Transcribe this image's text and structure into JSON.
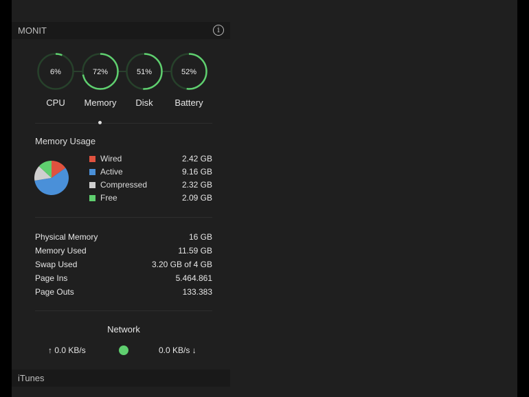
{
  "widget": {
    "title": "MONIT",
    "info_icon": "info-icon",
    "gauges": [
      {
        "label": "CPU",
        "value": "6%",
        "fraction": 0.06
      },
      {
        "label": "Memory",
        "value": "72%",
        "fraction": 0.72
      },
      {
        "label": "Disk",
        "value": "51%",
        "fraction": 0.51
      },
      {
        "label": "Battery",
        "value": "52%",
        "fraction": 0.52
      }
    ],
    "gauge_color": "#5fcf6f",
    "memory_usage": {
      "title": "Memory Usage",
      "items": [
        {
          "name": "Wired",
          "value": "2.42 GB",
          "gb": 2.42,
          "color": "#e0523f"
        },
        {
          "name": "Active",
          "value": "9.16 GB",
          "gb": 9.16,
          "color": "#4a90d9"
        },
        {
          "name": "Compressed",
          "value": "2.32 GB",
          "gb": 2.32,
          "color": "#cfcfcf"
        },
        {
          "name": "Free",
          "value": "2.09 GB",
          "gb": 2.09,
          "color": "#5fcf6f"
        }
      ]
    },
    "stats": [
      {
        "label": "Physical Memory",
        "value": "16 GB"
      },
      {
        "label": "Memory Used",
        "value": "11.59 GB"
      },
      {
        "label": "Swap Used",
        "value": "3.20 GB of 4 GB"
      },
      {
        "label": "Page Ins",
        "value": "5.464.861"
      },
      {
        "label": "Page Outs",
        "value": "133.383"
      }
    ],
    "network": {
      "title": "Network",
      "upload": "↑ 0.0 KB/s",
      "download": "0.0 KB/s ↓",
      "status_color": "#5fcf6f"
    }
  },
  "next_widget": {
    "title": "iTunes"
  }
}
